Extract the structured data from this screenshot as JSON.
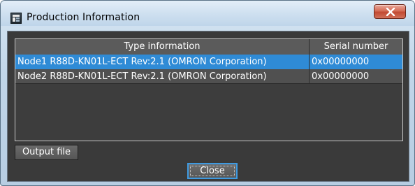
{
  "window": {
    "title": "Production Information",
    "close_icon": "close-x-icon",
    "app_icon": "window-app-icon"
  },
  "table": {
    "columns": [
      "Type information",
      "Serial number"
    ],
    "rows": [
      {
        "type": "Node1 R88D-KN01L-ECT Rev:2.1 (OMRON Corporation)",
        "serial": "0x00000000",
        "selected": true
      },
      {
        "type": "Node2 R88D-KN01L-ECT Rev:2.1 (OMRON Corporation)",
        "serial": "0x00000000",
        "selected": false
      }
    ]
  },
  "buttons": {
    "output_file": "Output file",
    "close": "Close"
  },
  "colors": {
    "selection": "#2f8bd6",
    "panel_background": "#3a3a3a",
    "close_button_red": "#c24a32"
  }
}
